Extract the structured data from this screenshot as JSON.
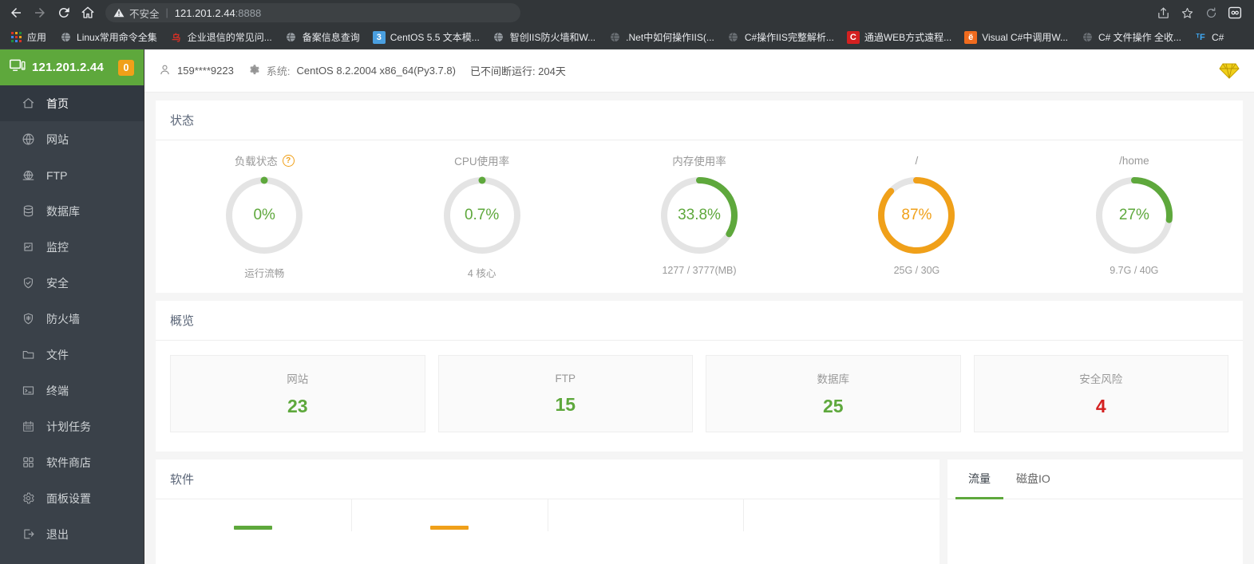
{
  "browser": {
    "nav": {
      "back": "back-arrow",
      "forward": "forward-arrow",
      "reload": "reload",
      "home": "home"
    },
    "omnibox": {
      "security_label": "不安全",
      "url_host": "121.201.2.44",
      "url_port": ":8888"
    },
    "right_icons": [
      "share-icon",
      "star-icon",
      "sync-icon",
      "profile-icon"
    ],
    "bookmarks": [
      {
        "label": "应用",
        "icon": "apps-grid-icon",
        "color": "#4285f4"
      },
      {
        "label": "Linux常用命令全集",
        "icon": "globe-icon",
        "color": "#9aa0a6"
      },
      {
        "label": "企业退信的常见问...",
        "icon": "red-mark-icon",
        "color": "#d93025"
      },
      {
        "label": "备案信息查询",
        "icon": "globe-icon",
        "color": "#9aa0a6"
      },
      {
        "label": "CentOS 5.5 文本模...",
        "icon": "blue-square-icon",
        "color": "#4a9fe0"
      },
      {
        "label": "智创IIS防火墙和W...",
        "icon": "globe-icon",
        "color": "#9aa0a6"
      },
      {
        "label": ".Net中如何操作IIS(...",
        "icon": "globe-icon",
        "color": "#6b7075"
      },
      {
        "label": "C#操作IIS完整解析...",
        "icon": "globe-icon",
        "color": "#6b7075"
      },
      {
        "label": "通過WEB方式遠程...",
        "icon": "c-red-icon",
        "color": "#d42020"
      },
      {
        "label": "Visual C#中调用W...",
        "icon": "e-orange-icon",
        "color": "#f06b1e"
      },
      {
        "label": "C# 文件操作 全收...",
        "icon": "globe-icon",
        "color": "#6b7075"
      },
      {
        "label": "C#",
        "icon": "tf-icon",
        "color": "#3fa9f5"
      }
    ]
  },
  "sidebar": {
    "host": "121.201.2.44",
    "badge": "0",
    "logo_icon": "monitor-icon",
    "items": [
      {
        "label": "首页",
        "icon": "home-icon",
        "active": true
      },
      {
        "label": "网站",
        "icon": "globe-icon",
        "active": false
      },
      {
        "label": "FTP",
        "icon": "ftp-icon",
        "active": false
      },
      {
        "label": "数据库",
        "icon": "database-icon",
        "active": false
      },
      {
        "label": "监控",
        "icon": "monitor-chart-icon",
        "active": false
      },
      {
        "label": "安全",
        "icon": "shield-check-icon",
        "active": false
      },
      {
        "label": "防火墙",
        "icon": "firewall-icon",
        "active": false
      },
      {
        "label": "文件",
        "icon": "folder-icon",
        "active": false
      },
      {
        "label": "终端",
        "icon": "terminal-icon",
        "active": false
      },
      {
        "label": "计划任务",
        "icon": "calendar-icon",
        "active": false
      },
      {
        "label": "软件商店",
        "icon": "grid-icon",
        "active": false
      },
      {
        "label": "面板设置",
        "icon": "gear-icon",
        "active": false
      },
      {
        "label": "退出",
        "icon": "logout-icon",
        "active": false
      }
    ]
  },
  "topbar": {
    "user_icon": "user-icon",
    "username": "159****9223",
    "system_icon": "gear-icon",
    "system_label": "系统:",
    "system_value": "CentOS 8.2.2004 x86_64(Py3.7.8)",
    "uptime": "已不间断运行: 204天",
    "vip_icon": "diamond-icon"
  },
  "status": {
    "title": "状态",
    "gauges": [
      {
        "title": "负载状态",
        "has_help": true,
        "help": "?",
        "value": "0%",
        "sub": "运行流畅",
        "percent": 0,
        "color": "#5ea83c",
        "dot": true
      },
      {
        "title": "CPU使用率",
        "has_help": false,
        "help": "",
        "value": "0.7%",
        "sub": "4 核心",
        "percent": 0.7,
        "color": "#5ea83c",
        "dot": true
      },
      {
        "title": "内存使用率",
        "has_help": false,
        "help": "",
        "value": "33.8%",
        "sub": "1277 / 3777(MB)",
        "percent": 33.8,
        "color": "#5ea83c",
        "dot": false
      },
      {
        "title": "/",
        "has_help": false,
        "help": "",
        "value": "87%",
        "sub": "25G / 30G",
        "percent": 87,
        "color": "#f0a019",
        "dot": false
      },
      {
        "title": "/home",
        "has_help": false,
        "help": "",
        "value": "27%",
        "sub": "9.7G / 40G",
        "percent": 27,
        "color": "#5ea83c",
        "dot": false
      }
    ]
  },
  "overview": {
    "title": "概览",
    "cards": [
      {
        "label": "网站",
        "value": "23",
        "color": "#5ea83c"
      },
      {
        "label": "FTP",
        "value": "15",
        "color": "#5ea83c"
      },
      {
        "label": "数据库",
        "value": "25",
        "color": "#5ea83c"
      },
      {
        "label": "安全风险",
        "value": "4",
        "color": "#d42020"
      }
    ]
  },
  "software": {
    "title": "软件",
    "bars": [
      {
        "color": "#5ea83c"
      },
      {
        "color": "#f0a019"
      },
      {
        "color": "#ffffff"
      },
      {
        "color": "#ffffff"
      }
    ]
  },
  "chart_panel": {
    "tabs": [
      {
        "label": "流量",
        "active": true
      },
      {
        "label": "磁盘IO",
        "active": false
      }
    ]
  },
  "colors": {
    "accent_green": "#5ea83c",
    "warn_orange": "#f0a019",
    "danger_red": "#d42020",
    "sidebar_dark": "#3a4149",
    "sidebar_active": "#313840"
  }
}
